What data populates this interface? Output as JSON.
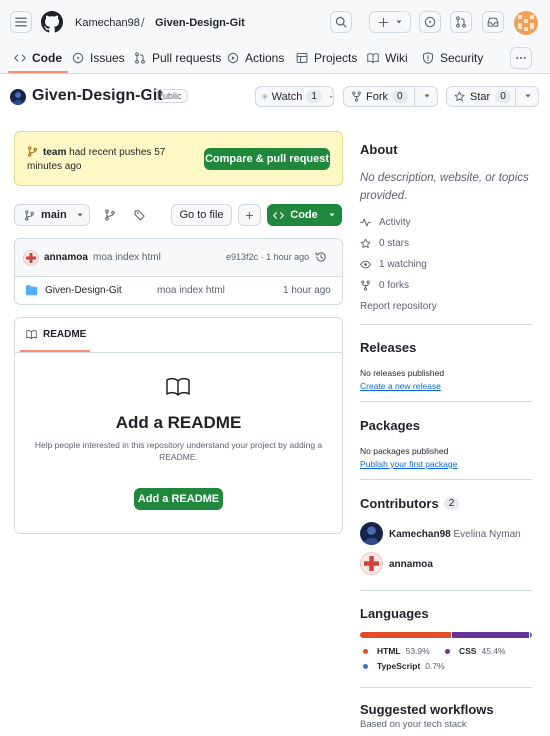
{
  "header": {
    "owner": "Kamechan98",
    "separator": "/",
    "repo": "Given-Design-Git"
  },
  "nav": {
    "tabs": [
      {
        "label": "Code",
        "icon": "code-icon"
      },
      {
        "label": "Issues",
        "icon": "issue-icon"
      },
      {
        "label": "Pull requests",
        "icon": "pull-request-icon"
      },
      {
        "label": "Actions",
        "icon": "play-icon"
      },
      {
        "label": "Projects",
        "icon": "table-icon"
      },
      {
        "label": "Wiki",
        "icon": "book-icon"
      },
      {
        "label": "Security",
        "icon": "shield-icon"
      }
    ],
    "active": "Code"
  },
  "repo_header": {
    "name": "Given-Design-Git",
    "visibility": "Public",
    "watch_label": "Watch",
    "watch_count": "1",
    "fork_label": "Fork",
    "fork_count": "0",
    "star_label": "Star",
    "star_count": "0"
  },
  "push_banner": {
    "branch": "team",
    "message": "had recent pushes 57 minutes ago",
    "button": "Compare & pull request"
  },
  "toolbar": {
    "branch": "main",
    "go_to_file": "Go to file",
    "add": "+",
    "code": "Code"
  },
  "commit": {
    "author": "annamoa",
    "message": "moa index html",
    "sha": "e913f2c",
    "dot": "·",
    "time": "1 hour ago"
  },
  "files": [
    {
      "name": "Given-Design-Git",
      "message": "moa index html",
      "time": "1 hour ago"
    }
  ],
  "readme": {
    "tab": "README",
    "title": "Add a README",
    "description": "Help people interested in this repository understand your project by adding a README.",
    "button": "Add a README"
  },
  "about": {
    "heading": "About",
    "description": "No description, website, or topics provided.",
    "items": [
      "Activity",
      "0 stars",
      "1 watching",
      "0 forks"
    ],
    "report": "Report repository"
  },
  "releases": {
    "heading": "Releases",
    "text": "No releases published",
    "link": "Create a new release"
  },
  "packages": {
    "heading": "Packages",
    "text": "No packages published",
    "link": "Publish your first package"
  },
  "contributors": {
    "heading": "Contributors",
    "count": "2",
    "people": [
      {
        "login": "Kamechan98",
        "name": "Evelina Nyman"
      },
      {
        "login": "annamoa",
        "name": ""
      }
    ]
  },
  "languages": {
    "heading": "Languages",
    "items": [
      {
        "name": "HTML",
        "percent": "53.9%",
        "value": 53.9,
        "color": "#e34c26"
      },
      {
        "name": "CSS",
        "percent": "45.4%",
        "value": 45.4,
        "color": "#663399"
      },
      {
        "name": "TypeScript",
        "percent": "0.7%",
        "value": 0.7,
        "color": "#3178c6"
      }
    ]
  },
  "workflows": {
    "heading": "Suggested workflows",
    "text": "Based on your tech stack"
  },
  "colors": {
    "accent": "#0969da",
    "green": "#1f883d",
    "tab_underline": "#fd8c73",
    "banner_bg": "#fff8c5"
  }
}
